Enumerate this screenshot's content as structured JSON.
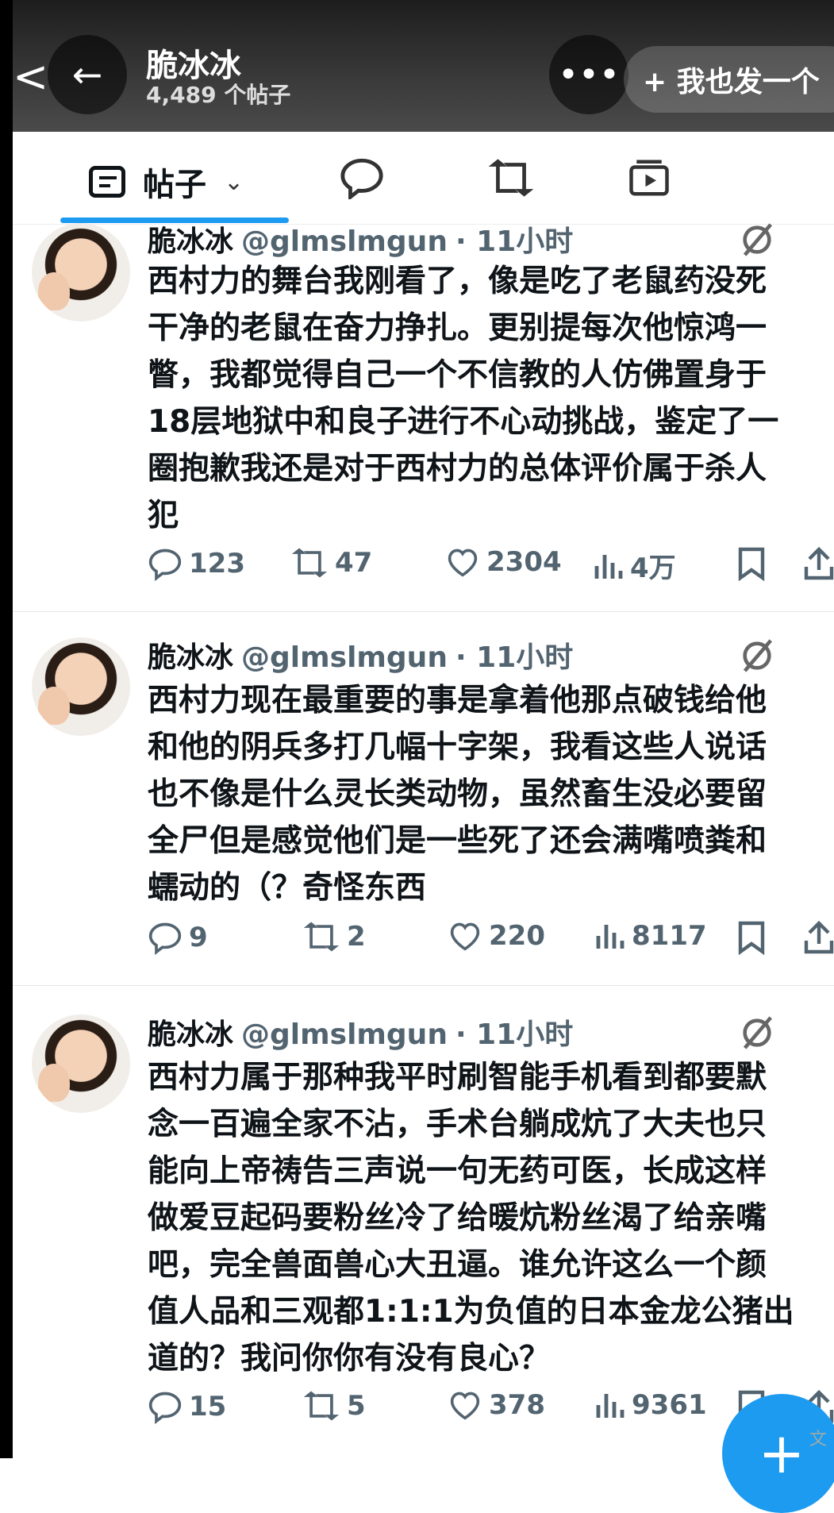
{
  "header": {
    "left_chevron": "<",
    "back_icon": "←",
    "name": "脆冰冰",
    "post_count": "4,489 个帖子",
    "more_icon": "•••",
    "post_button_label": "+ 我也发一个"
  },
  "tabs": {
    "posts_label": "帖子",
    "dropdown_icon": "chevron-down-icon"
  },
  "tweets": [
    {
      "name": "脆冰冰",
      "handle": "@glmslmgun",
      "time": "· 11小时",
      "text": "西村力的舞台我刚看了，像是吃了老鼠药没死\n干净的老鼠在奋力挣扎。更别提每次他惊鸿一\n瞥，我都觉得自己一个不信教的人仿佛置身于\n18层地狱中和良子进行不心动挑战，鉴定了一\n圈抱歉我还是对于西村力的总体评价属于杀人\n犯",
      "replies": "123",
      "reposts": "47",
      "likes": "2304",
      "views": "4万"
    },
    {
      "name": "脆冰冰",
      "handle": "@glmslmgun",
      "time": "· 11小时",
      "text": "西村力现在最重要的事是拿着他那点破钱给他\n和他的阴兵多打几幅十字架，我看这些人说话\n也不像是什么灵长类动物，虽然畜生没必要留\n全尸但是感觉他们是一些死了还会满嘴喷粪和\n蠕动的（？奇怪东西",
      "replies": "9",
      "reposts": "2",
      "likes": "220",
      "views": "8117"
    },
    {
      "name": "脆冰冰",
      "handle": "@glmslmgun",
      "time": "· 11小时",
      "text": "西村力属于那种我平时刷智能手机看到都要默\n念一百遍全家不沾，手术台躺成炕了大夫也只\n能向上帝祷告三声说一句无药可医，长成这样\n做爱豆起码要粉丝冷了给暖炕粉丝渴了给亲嘴\n吧，完全兽面兽心大丑逼。谁允许这么一个颜\n值人品和三观都1:1:1为负值的日本金龙公猪出\n道的？我问你你有没有良心？",
      "replies": "15",
      "reposts": "5",
      "likes": "378",
      "views": "9361"
    }
  ],
  "fab_label": "+",
  "corner_mark": "文",
  "colors": {
    "accent": "#1d9bf0",
    "text": "#0f1419",
    "muted": "#536471"
  }
}
